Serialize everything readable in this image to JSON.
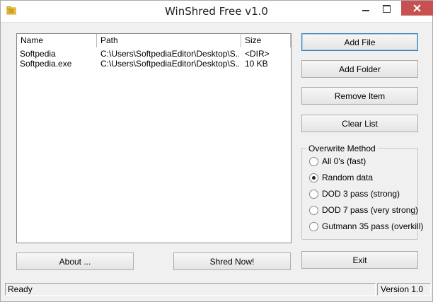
{
  "window": {
    "title": "WinShred Free v1.0"
  },
  "list": {
    "columns": [
      "Name",
      "Path",
      "Size"
    ],
    "rows": [
      {
        "name": "Softpedia",
        "path": "C:\\Users\\SoftpediaEditor\\Desktop\\S...",
        "size": "<DIR>"
      },
      {
        "name": "Softpedia.exe",
        "path": "C:\\Users\\SoftpediaEditor\\Desktop\\S...",
        "size": "10 KB"
      }
    ]
  },
  "buttons": {
    "add_file": "Add File",
    "add_folder": "Add Folder",
    "remove_item": "Remove Item",
    "clear_list": "Clear List",
    "about": "About ...",
    "shred_now": "Shred Now!",
    "exit": "Exit"
  },
  "overwrite": {
    "label": "Overwrite Method",
    "selected": 1,
    "options": [
      "All 0's (fast)",
      "Random data",
      "DOD 3 pass (strong)",
      "DOD 7 pass (very strong)",
      "Gutmann 35 pass (overkill)"
    ]
  },
  "status": {
    "text": "Ready",
    "version": "Version 1.0"
  },
  "colors": {
    "close_button": "#c75050",
    "default_button_border": "#3c7fb1",
    "app_icon": "#e8b200"
  },
  "icons": {
    "app": "folder-shred-icon",
    "minimize": "minimize-icon",
    "maximize": "maximize-icon",
    "close": "close-icon"
  }
}
